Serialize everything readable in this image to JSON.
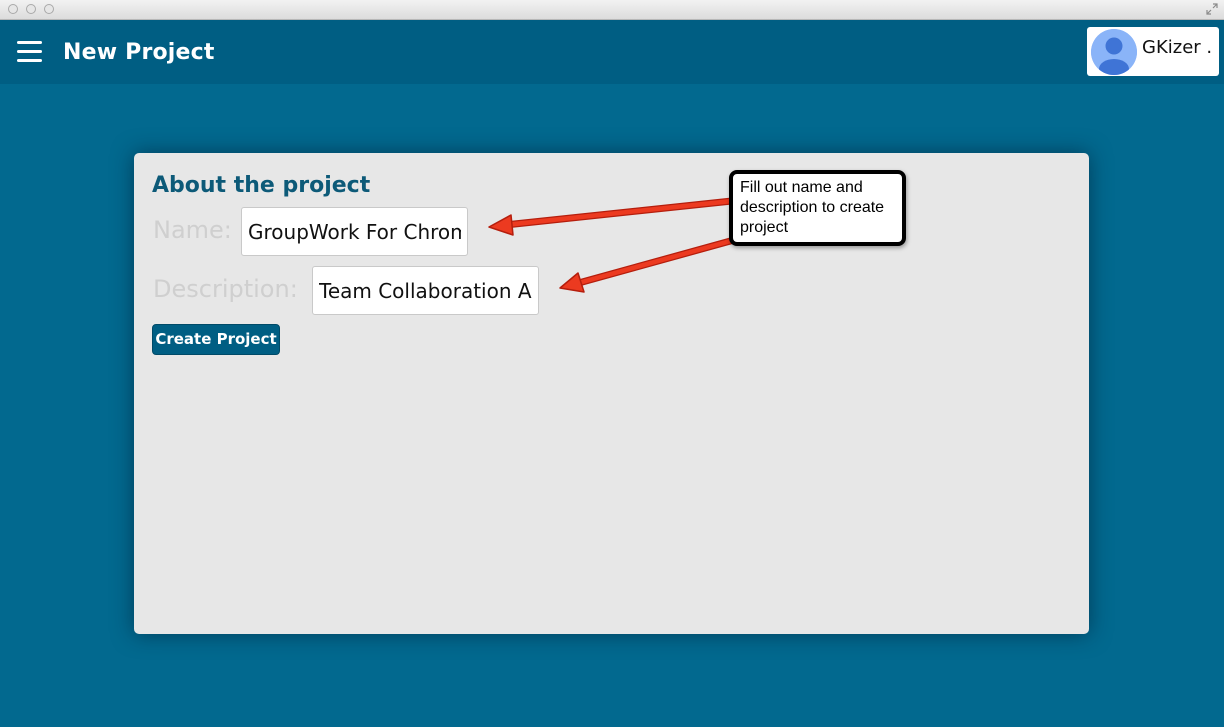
{
  "window": {
    "controls": [
      "close",
      "minimize",
      "zoom"
    ],
    "resize_icon": "fullscreen-arrows-icon"
  },
  "appbar": {
    "menu_icon": "hamburger-menu-icon",
    "title": "New Project",
    "user": {
      "avatar_icon": "user-avatar-icon",
      "name": "GKizer ."
    }
  },
  "form": {
    "heading": "About the project",
    "name_label": "Name:",
    "name_value": "GroupWork For Chrome",
    "description_label": "Description:",
    "description_value": "Team Collaboration App",
    "submit_label": "Create Project"
  },
  "annotation": {
    "callout_text": "Fill out name and description to create project"
  },
  "colors": {
    "background": "#02698f",
    "appbar": "#005e83",
    "card": "#e7e7e7",
    "heading": "#0d5a78",
    "arrow": "#e8321b"
  }
}
